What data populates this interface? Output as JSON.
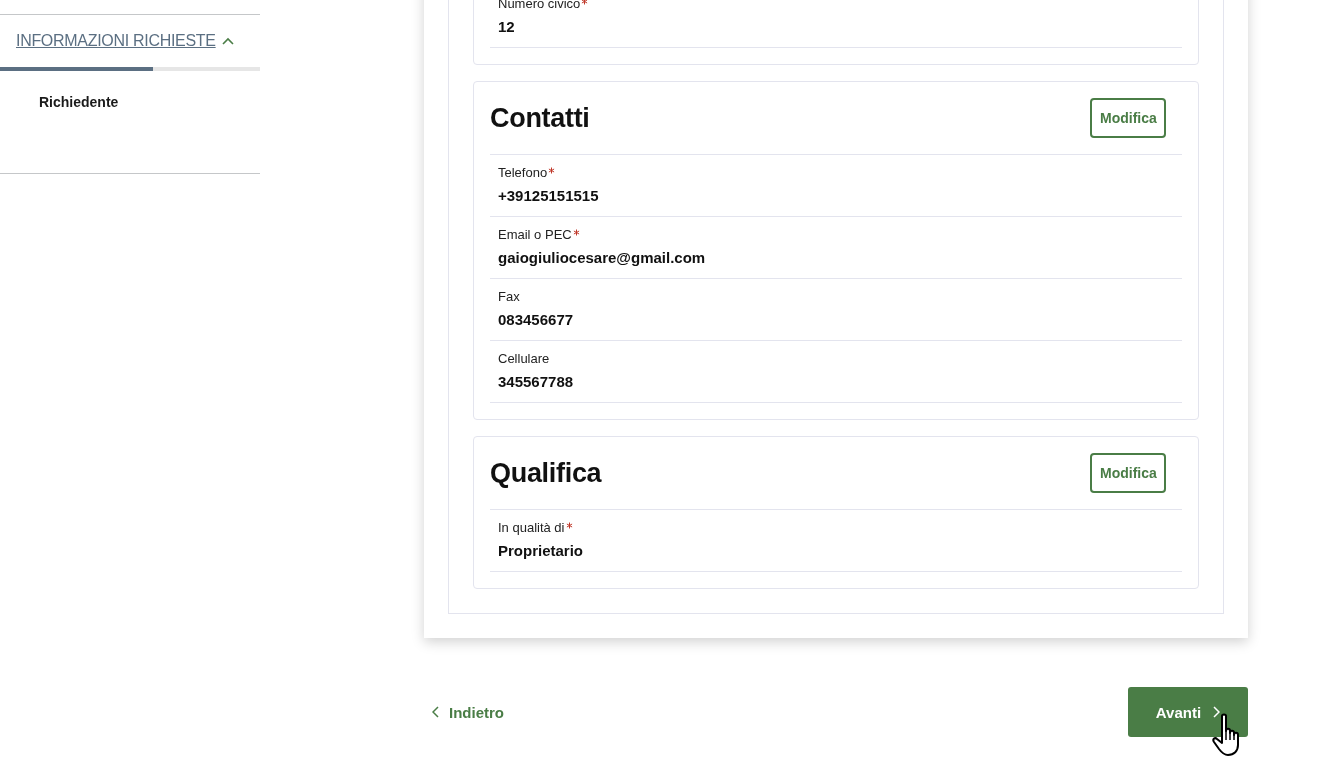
{
  "sidebar": {
    "heading": "INFORMAZIONI RICHIESTE",
    "expanded": true,
    "progress": {
      "level": 0.59
    },
    "items": [
      {
        "label": "Richiedente"
      }
    ]
  },
  "sections": [
    {
      "fields": [
        {
          "label": "Numero civico",
          "required": true,
          "value": "12"
        }
      ]
    },
    {
      "title": "Contatti",
      "edit_button": "Modifica",
      "fields": [
        {
          "label": "Telefono",
          "required": true,
          "value": "+39125151515"
        },
        {
          "label": "Email o PEC",
          "required": true,
          "value": "gaiogiuliocesare@gmail.com"
        },
        {
          "label": "Fax",
          "required": false,
          "value": "083456677"
        },
        {
          "label": "Cellulare",
          "required": false,
          "value": "345567788"
        }
      ]
    },
    {
      "title": "Qualifica",
      "edit_button": "Modifica",
      "fields": [
        {
          "label": "In qualità di",
          "required": true,
          "value": "Proprietario"
        }
      ]
    }
  ],
  "nav": {
    "back": "Indietro",
    "next": "Avanti"
  }
}
